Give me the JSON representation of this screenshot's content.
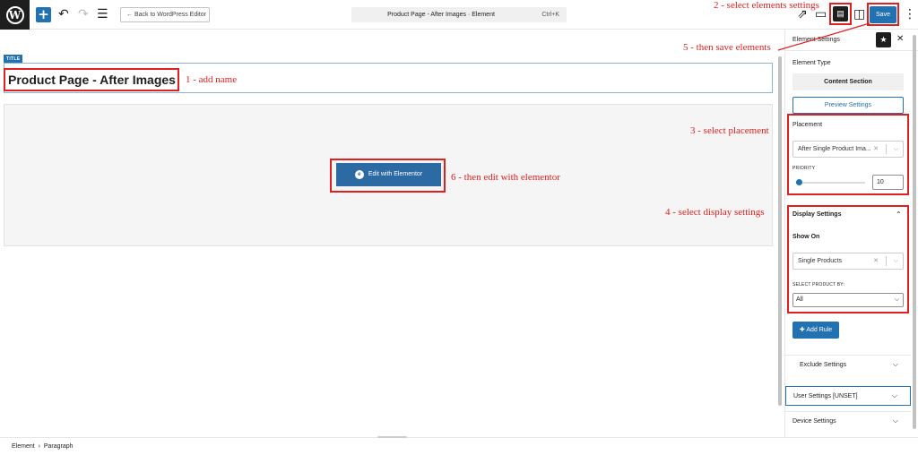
{
  "toolbar": {
    "wp_logo": "W",
    "add_label": "+",
    "undo_icon": "undo-icon",
    "redo_icon": "redo-icon",
    "list_view_icon": "list-view-icon",
    "back_label": "← Back to WordPress Editor",
    "document_title": "Product Page - After Images · Element",
    "shortcut": "Ctrl+K",
    "save_label": "Save"
  },
  "editor": {
    "title_tag": "TITLE",
    "post_title": "Product Page - After Images",
    "elementor_button": "Edit with Elementor",
    "elementor_icon": "e"
  },
  "statusbar": {
    "crumb_1": "Element",
    "separator": "›",
    "crumb_2": "Paragraph"
  },
  "sidebar": {
    "header_label": "Element Settings",
    "element_type_label": "Element Type",
    "element_type_value": "Content Section",
    "preview_button": "Preview Settings",
    "placement_label": "Placement",
    "placement_value": "After Single Product Ima...",
    "priority_label": "PRIORITY",
    "priority_value": "10",
    "priority_fraction": 0.02,
    "display_settings_label": "Display Settings",
    "show_on_label": "Show On",
    "show_on_value": "Single Products",
    "select_product_by_label": "SELECT PRODUCT BY:",
    "select_product_by_value": "All",
    "add_rule_label": "Add Rule",
    "exclude_settings_label": "Exclude Settings",
    "user_settings_label": "User Settings [UNSET]",
    "device_settings_label": "Device Settings"
  },
  "annotations": {
    "a1": "1 - add name",
    "a2": "2 - select elements settings",
    "a3": "3 - select placement",
    "a4": "4 - select display settings",
    "a5": "5 - then save elements",
    "a6": "6 - then edit with elementor"
  },
  "colors": {
    "accent": "#2271b1",
    "annotation_red": "#e02020"
  }
}
